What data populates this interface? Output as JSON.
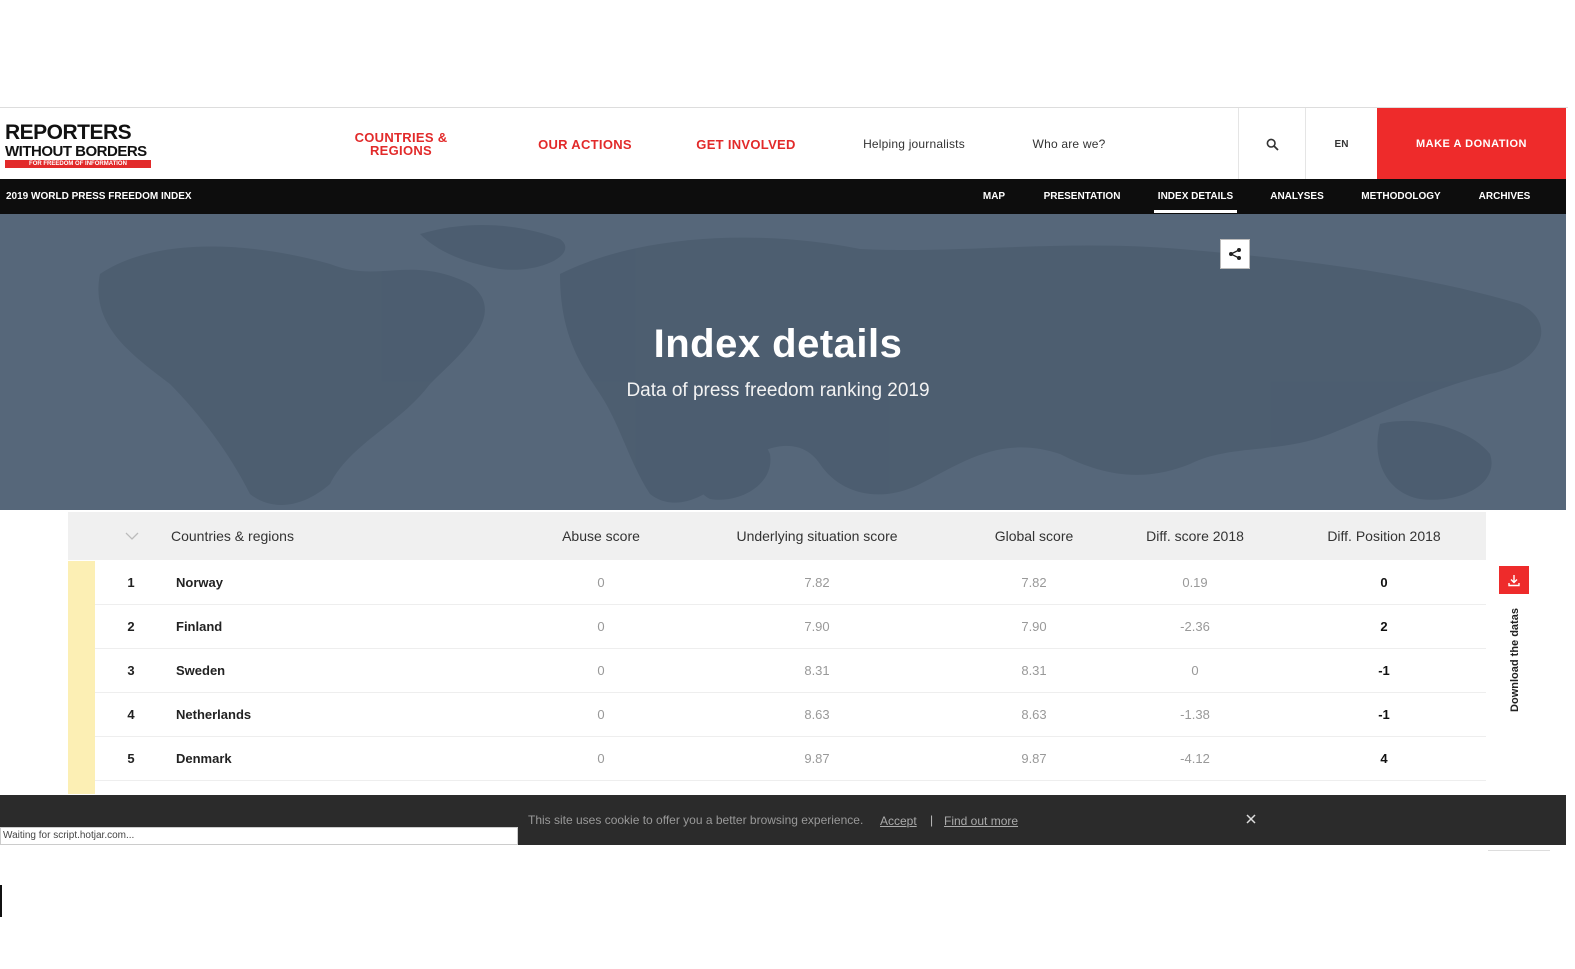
{
  "logo": {
    "line1": "REPORTERS",
    "line2": "WITHOUT BORDERS",
    "tagline": "FOR FREEDOM OF INFORMATION"
  },
  "nav": {
    "countries": "COUNTRIES & REGIONS",
    "actions": "OUR ACTIONS",
    "involved": "GET INVOLVED",
    "helping": "Helping journalists",
    "who": "Who are we?",
    "language": "EN",
    "donate": "MAKE A DONATION"
  },
  "subnav": {
    "title": "2019 WORLD PRESS FREEDOM INDEX",
    "items": [
      "MAP",
      "PRESENTATION",
      "INDEX DETAILS",
      "ANALYSES",
      "METHODOLOGY",
      "ARCHIVES"
    ],
    "active": "INDEX DETAILS"
  },
  "hero": {
    "title": "Index details",
    "subtitle": "Data of press freedom ranking 2019"
  },
  "table": {
    "headers": {
      "country": "Countries & regions",
      "abuse": "Abuse score",
      "underlying": "Underlying situation score",
      "global": "Global score",
      "diff_score": "Diff. score 2018",
      "diff_position": "Diff. Position 2018"
    },
    "rows": [
      {
        "rank": "1",
        "country": "Norway",
        "abuse": "0",
        "underlying": "7.82",
        "global": "7.82",
        "diff_score": "0.19",
        "diff_position": "0"
      },
      {
        "rank": "2",
        "country": "Finland",
        "abuse": "0",
        "underlying": "7.90",
        "global": "7.90",
        "diff_score": "-2.36",
        "diff_position": "2"
      },
      {
        "rank": "3",
        "country": "Sweden",
        "abuse": "0",
        "underlying": "8.31",
        "global": "8.31",
        "diff_score": "0",
        "diff_position": "-1"
      },
      {
        "rank": "4",
        "country": "Netherlands",
        "abuse": "0",
        "underlying": "8.63",
        "global": "8.63",
        "diff_score": "-1.38",
        "diff_position": "-1"
      },
      {
        "rank": "5",
        "country": "Denmark",
        "abuse": "0",
        "underlying": "9.87",
        "global": "9.87",
        "diff_score": "-4.12",
        "diff_position": "4"
      }
    ],
    "stripe_color": "#fcefb4"
  },
  "download_label": "Download the datas",
  "cookie": {
    "text": "This site uses cookie to offer you a better browsing experience.",
    "accept": "Accept",
    "separator": "|",
    "find_out": "Find out more"
  },
  "status_bar": "Waiting for script.hotjar.com...",
  "colors": {
    "brand_red": "#ee2b2b",
    "hero_bg": "#56677a",
    "subnav_bg": "#0d0d0d"
  }
}
